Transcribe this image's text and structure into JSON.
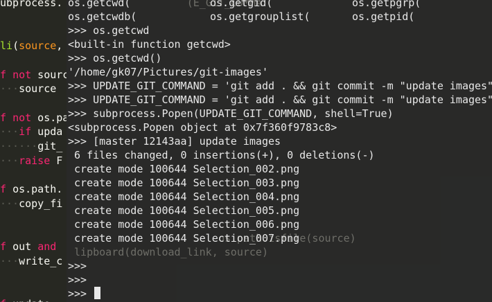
{
  "editor": {
    "lines": [
      {
        "parts": [
          {
            "t": "ubprocess.",
            "c": "pl"
          }
        ]
      },
      {
        "parts": [
          {
            "t": "",
            "c": "pl"
          }
        ]
      },
      {
        "parts": [
          {
            "t": "",
            "c": "pl"
          }
        ]
      },
      {
        "parts": [
          {
            "t": "li",
            "c": "fn"
          },
          {
            "t": "(",
            "c": "pl"
          },
          {
            "t": "source",
            "c": "ar"
          },
          {
            "t": ",",
            "c": "pl"
          }
        ]
      },
      {
        "parts": [
          {
            "t": "",
            "c": "pl"
          }
        ]
      },
      {
        "parts": [
          {
            "t": "f ",
            "c": "kw"
          },
          {
            "t": "not",
            "c": "kw"
          },
          {
            "t": " sourc",
            "c": "pl"
          }
        ]
      },
      {
        "parts": [
          {
            "t": "···",
            "c": "ws"
          },
          {
            "t": "source",
            "c": "pl"
          }
        ]
      },
      {
        "parts": [
          {
            "t": "",
            "c": "pl"
          }
        ]
      },
      {
        "parts": [
          {
            "t": "f ",
            "c": "kw"
          },
          {
            "t": "not",
            "c": "kw"
          },
          {
            "t": " os.pa",
            "c": "pl"
          }
        ]
      },
      {
        "parts": [
          {
            "t": "···",
            "c": "ws"
          },
          {
            "t": "if",
            "c": "kw"
          },
          {
            "t": " upda",
            "c": "pl"
          }
        ]
      },
      {
        "parts": [
          {
            "t": "······",
            "c": "ws"
          },
          {
            "t": "git_",
            "c": "pl"
          }
        ]
      },
      {
        "parts": [
          {
            "t": "···",
            "c": "ws"
          },
          {
            "t": "raise",
            "c": "kw"
          },
          {
            "t": " F",
            "c": "pl"
          }
        ]
      },
      {
        "parts": [
          {
            "t": "",
            "c": "pl"
          }
        ]
      },
      {
        "parts": [
          {
            "t": "f ",
            "c": "kw"
          },
          {
            "t": "os.path.",
            "c": "pl"
          }
        ]
      },
      {
        "parts": [
          {
            "t": "···",
            "c": "ws"
          },
          {
            "t": "copy_fi",
            "c": "pl"
          }
        ]
      },
      {
        "parts": [
          {
            "t": "",
            "c": "pl"
          }
        ]
      },
      {
        "parts": [
          {
            "t": "",
            "c": "pl"
          }
        ]
      },
      {
        "parts": [
          {
            "t": "f ",
            "c": "kw"
          },
          {
            "t": "out ",
            "c": "pl"
          },
          {
            "t": "and",
            "c": "kw"
          }
        ]
      },
      {
        "parts": [
          {
            "t": "···",
            "c": "ws"
          },
          {
            "t": "write_c",
            "c": "pl"
          }
        ]
      },
      {
        "parts": [
          {
            "t": "",
            "c": "pl"
          }
        ]
      },
      {
        "parts": [
          {
            "t": "",
            "c": "pl"
          }
        ]
      },
      {
        "parts": [
          {
            "t": "f ",
            "c": "kw"
          },
          {
            "t": "update:",
            "c": "pl"
          }
        ]
      }
    ]
  },
  "terminal": {
    "completions_row1": [
      "os.getcwd(",
      "os.getgid(",
      "os.getpgrp("
    ],
    "completions_row2": [
      "os.getcwdb(",
      "os.getgrouplist(",
      "os.getpid("
    ],
    "lines": [
      ">>> os.getcwd",
      "<built-in function getcwd>",
      ">>> os.getcwd()",
      "'/home/gk07/Pictures/git-images'",
      ">>> UPDATE_GIT_COMMAND = 'git add . && git commit -m \"update images\"'",
      ">>> UPDATE_GIT_COMMAND = 'git add . && git commit -m \"update images\"'",
      ">>> subprocess.Popen(UPDATE_GIT_COMMAND, shell=True)",
      "<subprocess.Popen object at 0x7f360f9783c8>",
      ">>> [master 12143aa] update images",
      " 6 files changed, 0 insertions(+), 0 deletions(-)",
      " create mode 100644 Selection_002.png",
      " create mode 100644 Selection_003.png",
      " create mode 100644 Selection_004.png",
      " create mode 100644 Selection_005.png",
      " create mode 100644 Selection_006.png",
      " create mode 100644 Selection_007.png",
      "",
      ">>> ",
      ">>> "
    ],
    "prompt": ">>> ",
    "ghost_lines": [
      {
        "text": "(E_GIT_COMMA",
        "line": 0,
        "col": 19
      },
      {
        "text": "lipboard(download_link, source)",
        "line": 18,
        "col": 1
      },
      {
        "text": "os.path.isfile(source)",
        "line": 17,
        "col": 24
      }
    ]
  }
}
